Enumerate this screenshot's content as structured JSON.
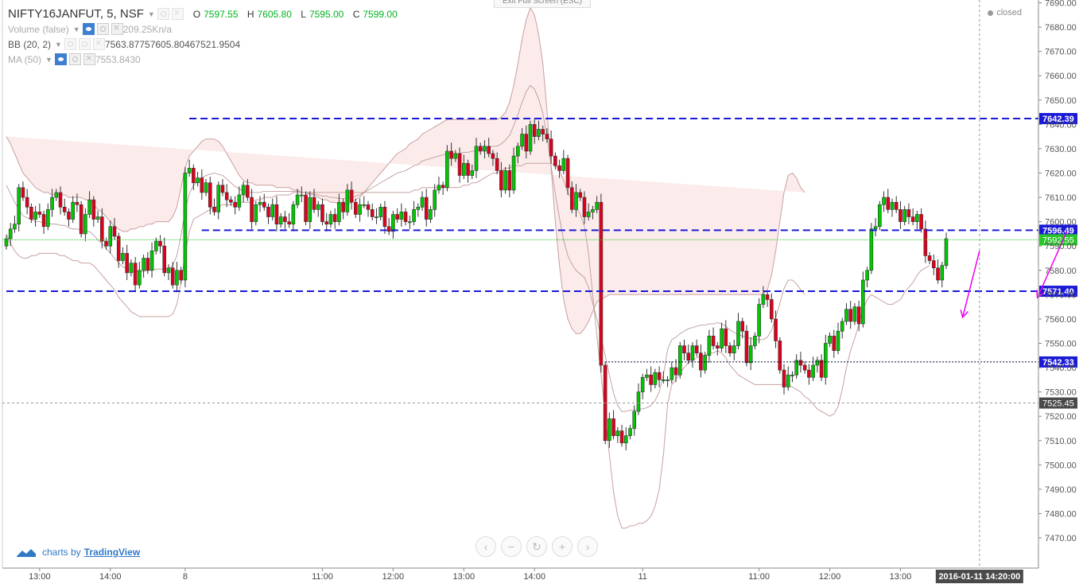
{
  "symbol": {
    "name": "NIFTY16JANFUT, 5, NSF"
  },
  "ohlc": {
    "o_label": "O",
    "o": "7597.55",
    "h_label": "H",
    "h": "7605.80",
    "l_label": "L",
    "l": "7595.00",
    "c_label": "C",
    "c": "7599.00"
  },
  "indicators": [
    {
      "label": "Volume (false)",
      "values": [
        "209.25K",
        "n/a"
      ]
    },
    {
      "label": "BB (20, 2)",
      "values": [
        "7563.8775",
        "7605.8046",
        "7521.9504"
      ]
    },
    {
      "label": "MA (50)",
      "values": [
        "7553.8430"
      ]
    }
  ],
  "exit_fullscreen": "Exit Full Screen (ESC)",
  "market_status": "closed",
  "branding": {
    "prefix": "charts by",
    "name": "TradingView"
  },
  "nav_icons": [
    "chevron-left-icon",
    "minus-icon",
    "reset-icon",
    "plus-icon",
    "chevron-right-icon"
  ],
  "colors": {
    "up": "#00c800",
    "down": "#e0001b",
    "levels": "#1a1ad6",
    "bb_fill": "#fbe4e4",
    "arrows": "#ee00ee",
    "last_price": "#2ac52a"
  },
  "chart_data": {
    "type": "candlestick",
    "ylim": [
      7465,
      7692
    ],
    "y_ticks": [
      "7690.00",
      "7680.00",
      "7670.00",
      "7660.00",
      "7650.00",
      "7640.00",
      "7630.00",
      "7620.00",
      "7610.00",
      "7600.00",
      "7590.00",
      "7580.00",
      "7570.00",
      "7560.00",
      "7550.00",
      "7540.00",
      "7530.00",
      "7520.00",
      "7510.00",
      "7500.00",
      "7490.00",
      "7480.00",
      "7470.00"
    ],
    "x_ticks": [
      {
        "label": "13:00",
        "i": 8
      },
      {
        "label": "14:00",
        "i": 25
      },
      {
        "label": "8",
        "i": 43
      },
      {
        "label": "11:00",
        "i": 76
      },
      {
        "label": "12:00",
        "i": 93
      },
      {
        "label": "13:00",
        "i": 110
      },
      {
        "label": "14:00",
        "i": 127
      },
      {
        "label": "11",
        "i": 153
      },
      {
        "label": "11:00",
        "i": 181
      },
      {
        "label": "12:00",
        "i": 198
      },
      {
        "label": "13:00",
        "i": 215
      }
    ],
    "crosshair": {
      "label": "2016-01-11 14:20:00",
      "i": 234,
      "price": "7525.45",
      "value": 7525.45
    },
    "price_levels": [
      {
        "label": "7642.39",
        "value": 7642.39,
        "start_i": 44,
        "style": "dashed"
      },
      {
        "label": "7596.49",
        "value": 7596.49,
        "start_i": 47,
        "style": "dashed"
      },
      {
        "label": "7571.40",
        "value": 7571.4,
        "start_i": 0,
        "style": "dashed"
      },
      {
        "label": "7542.33",
        "value": 7542.33,
        "start_i": 144,
        "style": "dotted"
      }
    ],
    "last_price": {
      "label": "7592.55",
      "value": 7592.55
    },
    "closes": [
      7593,
      7597,
      7599,
      7614,
      7610,
      7606,
      7601,
      7604,
      7603,
      7598,
      7605,
      7610,
      7612,
      7606,
      7604,
      7601,
      7608,
      7607,
      7595,
      7603,
      7609,
      7601,
      7602,
      7592,
      7590,
      7598,
      7594,
      7584,
      7587,
      7579,
      7583,
      7574,
      7580,
      7585,
      7580,
      7588,
      7592,
      7590,
      7579,
      7581,
      7574,
      7580,
      7576,
      7620,
      7622,
      7616,
      7618,
      7612,
      7616,
      7606,
      7604,
      7615,
      7612,
      7609,
      7608,
      7606,
      7611,
      7615,
      7610,
      7600,
      7607,
      7608,
      7606,
      7602,
      7607,
      7599,
      7602,
      7600,
      7599,
      7607,
      7611,
      7611,
      7600,
      7610,
      7605,
      7607,
      7600,
      7599,
      7603,
      7600,
      7608,
      7604,
      7613,
      7608,
      7603,
      7607,
      7607,
      7605,
      7602,
      7602,
      7606,
      7598,
      7596,
      7603,
      7601,
      7604,
      7600,
      7600,
      7605,
      7606,
      7610,
      7601,
      7605,
      7613,
      7615,
      7614,
      7629,
      7626,
      7628,
      7619,
      7624,
      7619,
      7621,
      7631,
      7629,
      7631,
      7628,
      7626,
      7621,
      7613,
      7621,
      7613,
      7627,
      7631,
      7636,
      7629,
      7640,
      7635,
      7638,
      7636,
      7634,
      7627,
      7623,
      7621,
      7626,
      7614,
      7605,
      7612,
      7610,
      7602,
      7604,
      7605,
      7608,
      7541,
      7510,
      7519,
      7512,
      7514,
      7509,
      7512,
      7515,
      7522,
      7530,
      7536,
      7537,
      7533,
      7538,
      7535,
      7535,
      7535,
      7540,
      7537,
      7549,
      7546,
      7543,
      7549,
      7546,
      7539,
      7545,
      7553,
      7549,
      7548,
      7556,
      7549,
      7546,
      7549,
      7559,
      7555,
      7542,
      7549,
      7553,
      7566,
      7570,
      7568,
      7560,
      7551,
      7539,
      7532,
      7537,
      7537,
      7543,
      7541,
      7539,
      7536,
      7541,
      7543,
      7536,
      7550,
      7553,
      7547,
      7555,
      7559,
      7564,
      7559,
      7565,
      7558,
      7576,
      7580,
      7597,
      7598,
      7607,
      7610,
      7605,
      7608,
      7605,
      7600,
      7605,
      7602,
      7600,
      7603,
      7597,
      7586,
      7584,
      7581,
      7576,
      7582,
      7593
    ],
    "bb_upper": [
      7635,
      7632,
      7628,
      7624,
      7620,
      7618,
      7616,
      7614,
      7613,
      7612,
      7612,
      7611,
      7611,
      7611,
      7611,
      7610,
      7610,
      7610,
      7610,
      7609,
      7609,
      7607,
      7605,
      7604,
      7602,
      7600,
      7598,
      7597,
      7596,
      7596,
      7597,
      7597,
      7598,
      7598,
      7599,
      7599,
      7600,
      7600,
      7600,
      7600,
      7602,
      7606,
      7614,
      7622,
      7627,
      7629,
      7631,
      7633,
      7634,
      7634,
      7634,
      7633,
      7631,
      7628,
      7625,
      7622,
      7619,
      7617,
      7616,
      7616,
      7615,
      7615,
      7615,
      7615,
      7615,
      7614,
      7614,
      7614,
      7614,
      7613,
      7613,
      7612,
      7612,
      7611,
      7611,
      7610,
      7609,
      7609,
      7608,
      7608,
      7607,
      7607,
      7607,
      7608,
      7609,
      7610,
      7612,
      7614,
      7616,
      7618,
      7620,
      7622,
      7624,
      7626,
      7628,
      7629,
      7630,
      7632,
      7633,
      7634,
      7636,
      7637,
      7638,
      7639,
      7640,
      7641,
      7642,
      7642,
      7642,
      7642,
      7642,
      7642,
      7642,
      7642,
      7642,
      7642,
      7642,
      7642,
      7642,
      7643,
      7645,
      7649,
      7656,
      7665,
      7675,
      7683,
      7688,
      7685,
      7677,
      7665,
      7646,
      7622,
      7600,
      7582,
      7568,
      7560,
      7556,
      7554,
      7554,
      7556,
      7559,
      7563,
      7567,
      7568,
      7569,
      7570,
      7570,
      7570,
      7570,
      7570,
      7570,
      7570,
      7570,
      7570,
      7570,
      7570,
      7570,
      7570,
      7570,
      7570,
      7570,
      7570,
      7570,
      7570,
      7570,
      7570,
      7570,
      7570,
      7570,
      7570,
      7570,
      7570,
      7570,
      7570,
      7570,
      7570,
      7570,
      7570,
      7570,
      7570,
      7570,
      7570,
      7570,
      7572,
      7578,
      7588,
      7600,
      7612,
      7619,
      7620,
      7618,
      7614,
      7612
    ],
    "bb_lower": [
      7595,
      7591,
      7588,
      7586,
      7585,
      7585,
      7586,
      7586,
      7587,
      7587,
      7587,
      7587,
      7587,
      7586,
      7586,
      7585,
      7584,
      7584,
      7583,
      7583,
      7583,
      7582,
      7580,
      7578,
      7576,
      7574,
      7572,
      7569,
      7567,
      7565,
      7563,
      7562,
      7561,
      7561,
      7561,
      7561,
      7561,
      7561,
      7561,
      7561,
      7562,
      7566,
      7575,
      7587,
      7596,
      7601,
      7602,
      7603,
      7604,
      7605,
      7606,
      7606,
      7607,
      7607,
      7607,
      7607,
      7608,
      7608,
      7608,
      7608,
      7609,
      7609,
      7610,
      7610,
      7610,
      7611,
      7611,
      7611,
      7611,
      7612,
      7612,
      7612,
      7612,
      7612,
      7612,
      7612,
      7612,
      7612,
      7612,
      7612,
      7612,
      7612,
      7612,
      7612,
      7612,
      7612,
      7612,
      7612,
      7612,
      7612,
      7612,
      7612,
      7612,
      7612,
      7612,
      7612,
      7612,
      7612,
      7613,
      7613,
      7614,
      7614,
      7614,
      7614,
      7614,
      7614,
      7614,
      7614,
      7614,
      7614,
      7615,
      7615,
      7616,
      7616,
      7617,
      7618,
      7619,
      7620,
      7620,
      7621,
      7622,
      7622,
      7623,
      7623,
      7623,
      7624,
      7624,
      7624,
      7624,
      7624,
      7624,
      7624,
      7623,
      7621,
      7617,
      7612,
      7609,
      7606,
      7603,
      7598,
      7587,
      7570,
      7553,
      7537,
      7521,
      7504,
      7489,
      7479,
      7474,
      7474,
      7475,
      7475,
      7476,
      7476,
      7477,
      7479,
      7483,
      7490,
      7504,
      7525,
      7533,
      7535,
      7538,
      7540,
      7542,
      7543,
      7544,
      7545,
      7545,
      7546,
      7546,
      7547,
      7546,
      7544,
      7541,
      7539,
      7537,
      7536,
      7535,
      7534,
      7533,
      7533,
      7533,
      7533,
      7533,
      7533,
      7533,
      7533,
      7533,
      7532,
      7531,
      7530,
      7528,
      7527,
      7525,
      7523,
      7522,
      7521,
      7520,
      7521,
      7524,
      7531,
      7540,
      7547,
      7552,
      7558,
      7564,
      7568,
      7570,
      7569,
      7568,
      7567,
      7566,
      7566,
      7567,
      7568,
      7571,
      7573,
      7575,
      7578,
      7580,
      7581,
      7582
    ],
    "arrows": [
      {
        "from": [
          7588,
          234
        ],
        "to": [
          7561,
          230
        ]
      },
      {
        "from": [
          7596,
          255
        ],
        "to": [
          7569,
          248
        ]
      },
      {
        "from": [
          7556,
          262
        ],
        "to": [
          7556,
          308
        ]
      }
    ]
  }
}
